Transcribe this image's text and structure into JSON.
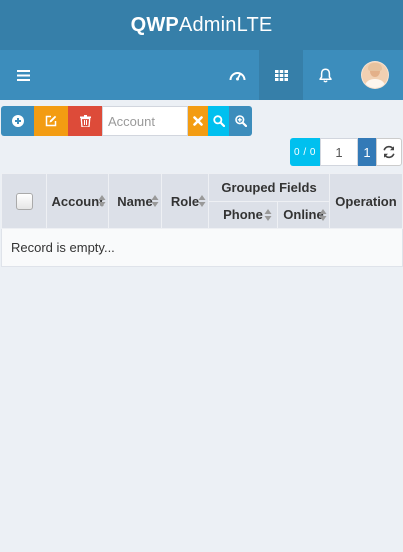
{
  "brand": {
    "bold": "QWP",
    "light": "AdminLTE"
  },
  "navbar": {
    "toggle_icon": "hamburger-icon",
    "items": [
      {
        "icon": "dashboard-gauge-icon"
      },
      {
        "icon": "apps-grid-icon",
        "active": true
      },
      {
        "icon": "bell-icon"
      },
      {
        "icon": "user-avatar"
      }
    ],
    "accent": "#3c8dbc"
  },
  "toolbar": {
    "search_placeholder": "Account",
    "search_value": ""
  },
  "pagination": {
    "count": "0 / 0",
    "page_input": "1",
    "current_page": "1"
  },
  "table": {
    "columns": {
      "account": "Account",
      "name": "Name",
      "role": "Role",
      "group": "Grouped Fields",
      "phone": "Phone",
      "online": "Online",
      "operation": "Operation"
    },
    "empty_message": "Record is empty..."
  }
}
